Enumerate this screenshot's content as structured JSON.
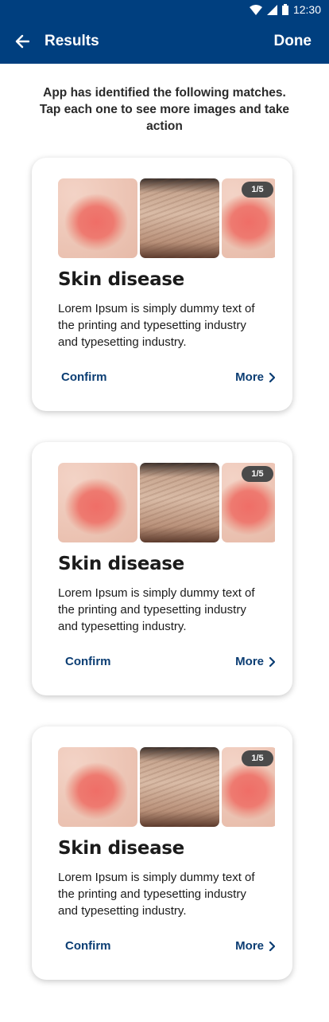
{
  "status_bar": {
    "time": "12:30"
  },
  "header": {
    "title": "Results",
    "done_label": "Done"
  },
  "intro": {
    "text": "App has identified the following matches. Tap each one to see more images and take action"
  },
  "colors": {
    "primary": "#003f7f",
    "link": "#0b3d73",
    "badge": "#4a4a4a"
  },
  "cards": [
    {
      "counter": "1/5",
      "title": "Skin disease",
      "description": "Lorem Ipsum is simply dummy text of the printing and typesetting industry and typesetting industry.",
      "confirm_label": "Confirm",
      "more_label": "More"
    },
    {
      "counter": "1/5",
      "title": "Skin disease",
      "description": "Lorem Ipsum is simply dummy text of the printing and typesetting industry and typesetting industry.",
      "confirm_label": "Confirm",
      "more_label": "More"
    },
    {
      "counter": "1/5",
      "title": "Skin disease",
      "description": "Lorem Ipsum is simply dummy text of the printing and typesetting industry and typesetting industry.",
      "confirm_label": "Confirm",
      "more_label": "More"
    }
  ]
}
